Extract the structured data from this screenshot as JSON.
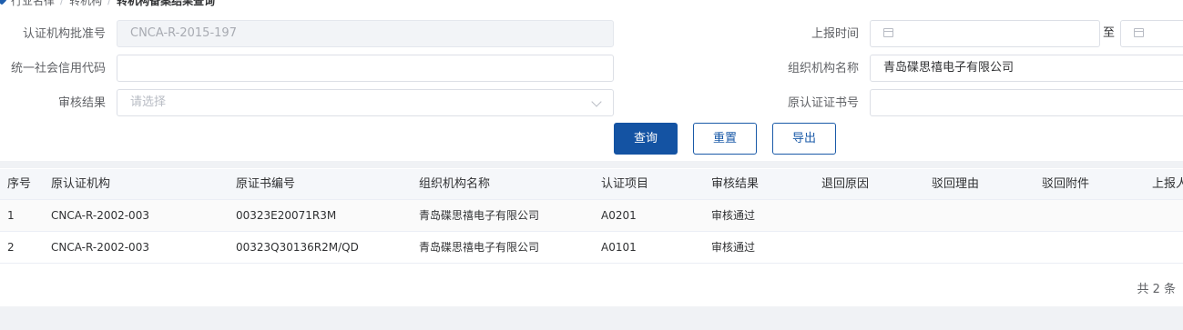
{
  "breadcrumb": {
    "items": [
      "行业名律",
      "转机构",
      "转机构备案结果查询"
    ]
  },
  "form": {
    "approval_no": {
      "label": "认证机构批准号",
      "value": "CNCA-R-2015-197"
    },
    "report_time": {
      "label": "上报时间",
      "separator": "至"
    },
    "credit_code": {
      "label": "统一社会信用代码",
      "value": ""
    },
    "org_name": {
      "label": "组织机构名称",
      "value": "青岛碟思禧电子有限公司"
    },
    "review_result": {
      "label": "审核结果",
      "placeholder": "请选择"
    },
    "orig_cert_no": {
      "label": "原认证证书号",
      "value": ""
    }
  },
  "buttons": {
    "query": "查询",
    "reset": "重置",
    "export": "导出"
  },
  "table": {
    "columns": [
      "序号",
      "原认证机构",
      "原证书编号",
      "组织机构名称",
      "认证项目",
      "审核结果",
      "退回原因",
      "驳回理由",
      "驳回附件",
      "上报人"
    ],
    "rows": [
      {
        "index": "1",
        "orig_org": "CNCA-R-2002-003",
        "cert_no": "00323E20071R3M",
        "org_name": "青岛碟思禧电子有限公司",
        "project": "A0201",
        "result": "审核通过",
        "return_reason": "",
        "reject_reason": "",
        "reject_attach": "",
        "reporter": ""
      },
      {
        "index": "2",
        "orig_org": "CNCA-R-2002-003",
        "cert_no": "00323Q30136R2M/QD",
        "org_name": "青岛碟思禧电子有限公司",
        "project": "A0101",
        "result": "审核通过",
        "return_reason": "",
        "reject_reason": "",
        "reject_attach": "",
        "reporter": ""
      }
    ]
  },
  "pagination": {
    "total_text": "共 2 条"
  },
  "colors": {
    "primary": "#1453a3",
    "header_bg": "#f5f7fa",
    "border": "#dcdfe6"
  }
}
